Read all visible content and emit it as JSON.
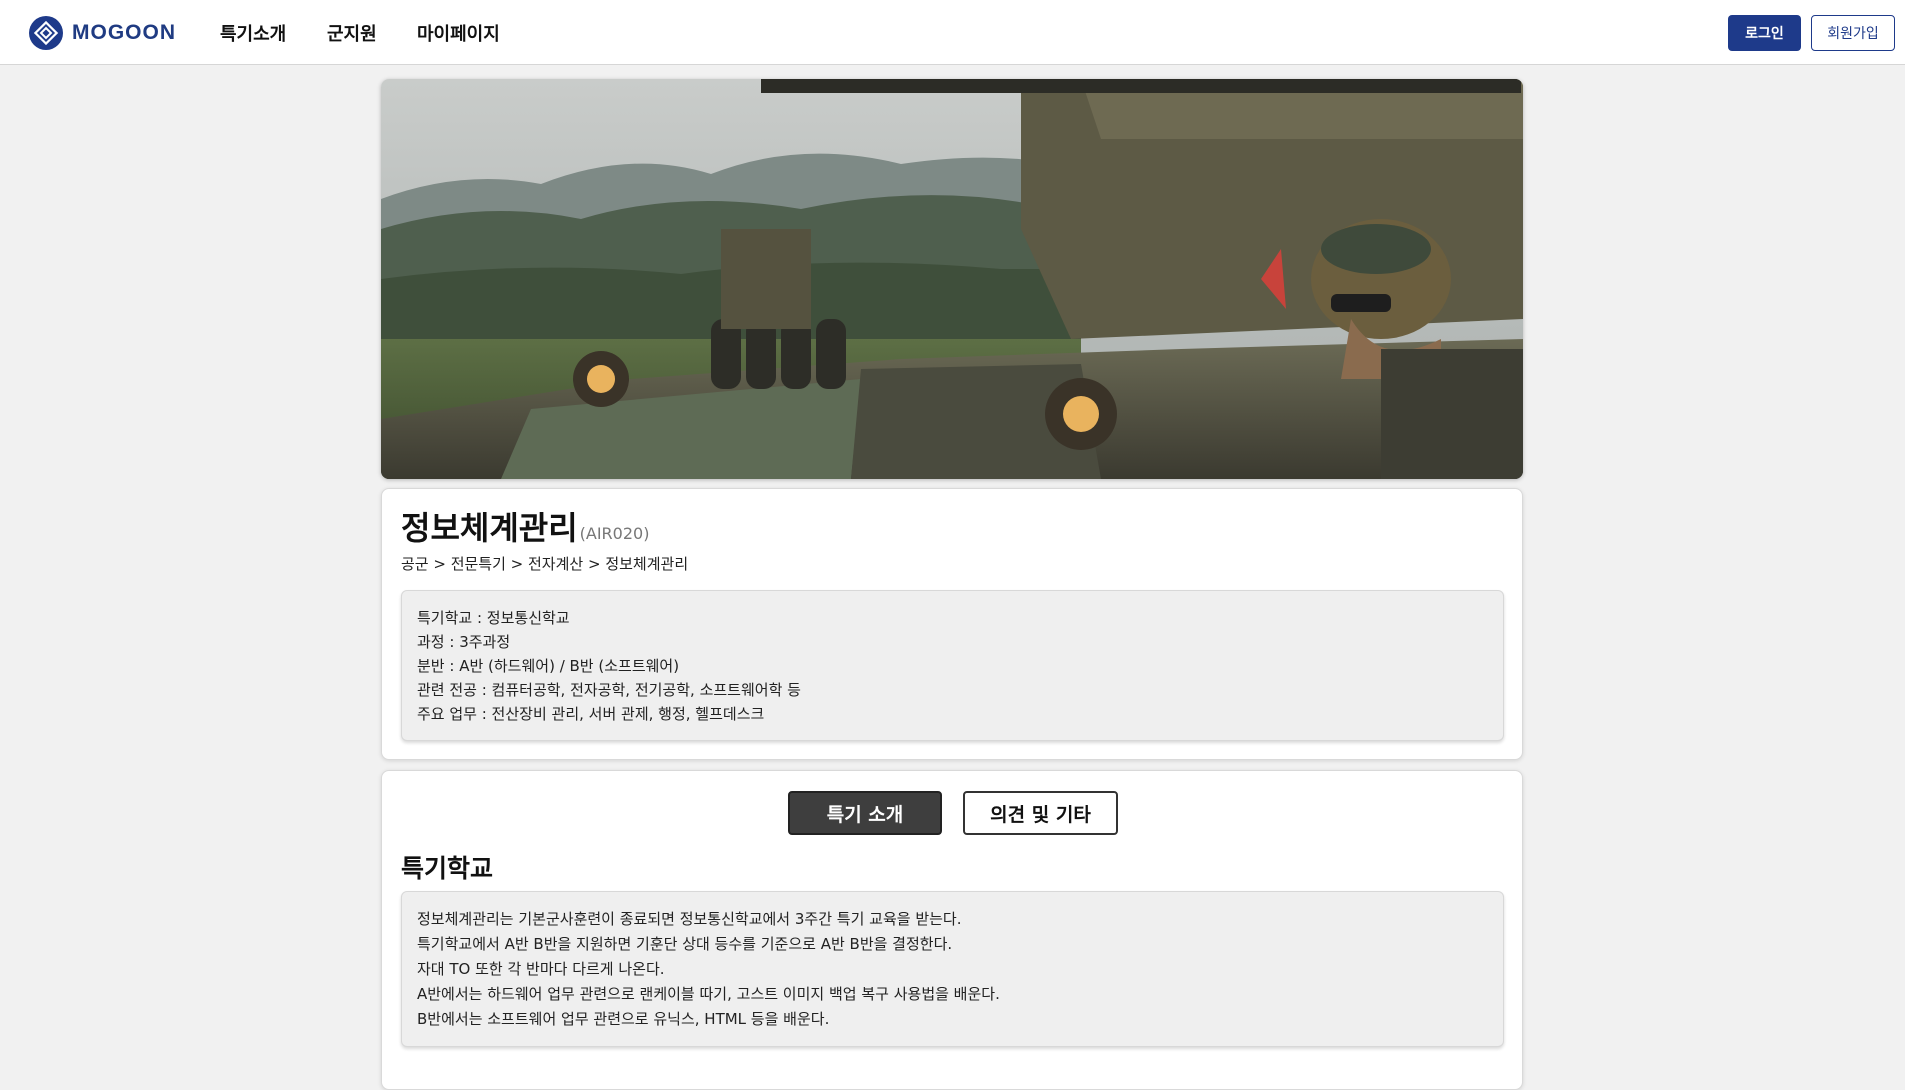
{
  "header": {
    "logo_text": "MOGOON",
    "nav": [
      "특기소개",
      "군지원",
      "마이페이지"
    ],
    "login_label": "로그인",
    "signup_label": "회원가입",
    "brand_color": "#1e3a8a"
  },
  "hero": {
    "image_description": "military-armored-vehicle-photo"
  },
  "specialty": {
    "title": "정보체계관리",
    "code": "(AIR020)",
    "breadcrumb": "공군 > 전문특기 > 전자계산 > 정보체계관리",
    "info": [
      "특기학교 : 정보통신학교",
      "과정 : 3주과정",
      "분반 : A반 (하드웨어) / B반 (소프트웨어)",
      "관련 전공 : 컴퓨터공학, 전자공학, 전기공학, 소프트웨어학 등",
      "주요 업무 : 전산장비 관리, 서버 관제, 행정, 헬프데스크"
    ]
  },
  "intro": {
    "tabs": [
      "특기 소개",
      "의견 및 기타"
    ],
    "active_tab": "특기 소개",
    "section_title": "특기학교",
    "description": [
      "정보체계관리는 기본군사훈련이 종료되면 정보통신학교에서 3주간 특기 교육을 받는다.",
      "특기학교에서 A반 B반을 지원하면 기훈단 상대 등수를 기준으로 A반 B반을 결정한다.",
      "자대 TO 또한 각 반마다 다르게 나온다.",
      "A반에서는 하드웨어 업무 관련으로 랜케이블 따기, 고스트 이미지 백업 복구 사용법을 배운다.",
      "B반에서는 소프트웨어 업무 관련으로 유닉스, HTML 등을 배운다."
    ]
  }
}
